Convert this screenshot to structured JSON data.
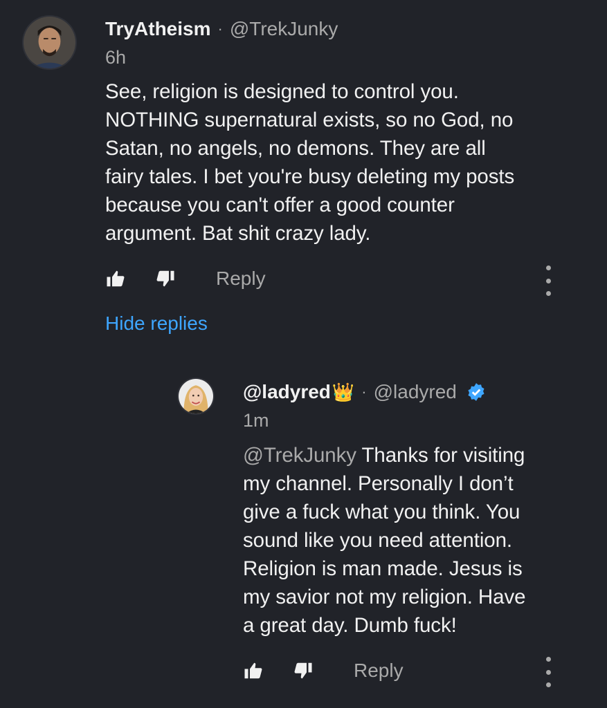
{
  "comment": {
    "author": "TryAtheism",
    "separator": "·",
    "handle": "@TrekJunky",
    "time": "6h",
    "text_lines": [
      "See, religion is designed to control you.",
      "NOTHING supernatural exists, so no God, no",
      "Satan, no angels, no demons. They are all",
      "fairy tales. I bet you're busy deleting my posts",
      "because you can't offer a good counter",
      "argument. Bat shit crazy lady."
    ],
    "like_icon": "thumbs-up-icon",
    "dislike_icon": "thumbs-down-icon",
    "reply_label": "Reply",
    "more_icon": "more-vert-icon"
  },
  "hide_replies_label": "Hide replies",
  "reply": {
    "author": "@ladyred",
    "author_emoji": "👑",
    "separator": "·",
    "handle": "@ladyred",
    "verified_icon": "verified-check-icon",
    "time": "1m",
    "mention": "@TrekJunky",
    "text_lines": [
      " Thanks for visiting",
      "my channel. Personally I don’t",
      "give a fuck what you think. You",
      "sound like you need attention.",
      "Religion is man made. Jesus is",
      "my savior not my religion. Have",
      "a great day. Dumb fuck!"
    ],
    "like_icon": "thumbs-up-icon",
    "dislike_icon": "thumbs-down-icon",
    "reply_label": "Reply",
    "more_icon": "more-vert-icon"
  },
  "colors": {
    "background": "#212329",
    "text": "#f1f1f1",
    "secondary": "#aaaaaa",
    "link": "#3ea6ff",
    "verified": "#3ea6ff"
  }
}
